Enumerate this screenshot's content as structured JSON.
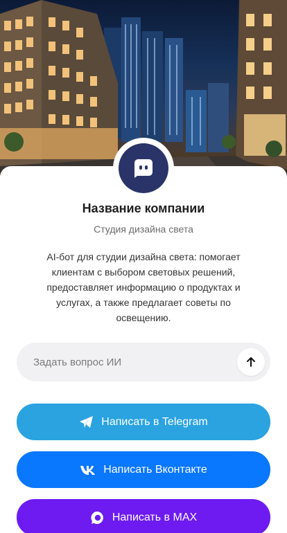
{
  "company": {
    "name": "Название компании",
    "subtitle": "Студия дизайна света",
    "description": "AI-бот для студии дизайна света: помогает клиентам с выбором световых решений, предоставляет информацию о продуктах и услугах, а также предлагает советы по освещению."
  },
  "ask": {
    "placeholder": "Задать вопрос ИИ",
    "send_icon": "arrow-up-icon"
  },
  "buttons": [
    {
      "label": "Написать в Telegram",
      "icon": "telegram-icon",
      "color": "#2aa3e0"
    },
    {
      "label": "Написать Вконтакте",
      "icon": "vk-icon",
      "color": "#0a77ff"
    },
    {
      "label": "Написать в MAX",
      "icon": "max-icon",
      "color": "#6d1bf0"
    }
  ],
  "colors": {
    "avatar_bg": "#2a3468",
    "input_bg": "#f1f1f3"
  }
}
